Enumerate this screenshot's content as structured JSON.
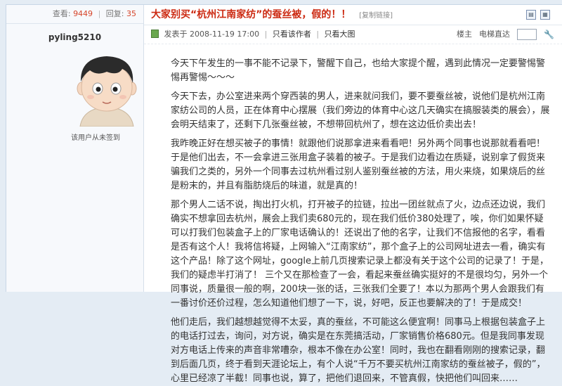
{
  "sidebar": {
    "views_label": "查看:",
    "views_value": "9449",
    "replies_label": "回复:",
    "replies_value": "35",
    "username": "pyling5210",
    "signed_status": "该用户从未签到"
  },
  "post": {
    "title": "大家别买“杭州江南家纺”的蚕丝被，假的！！",
    "copy_link": "[复制链接]",
    "posted_at": "发表于 2008-11-19 17:00",
    "author_only": "只看该作者",
    "read_large": "只看大图",
    "floor_label": "楼主",
    "goto_label": "电梯直达",
    "paragraphs": [
      "今天下午发生的一事不能不记录下，警醒下自己，也给大家提个醒，遇到此情况一定要警惕警惕再警惕～～～",
      "今天下去，办公室进来两个穿西装的男人，进来就问我们，要不要蚕丝被，说他们是杭州江南家纺公司的人员，正在体育中心摆展（我们旁边的体育中心这几天确实在搞服装类的展会），展会明天结束了，还剩下几张蚕丝被，不想带回杭州了，想在这边低价卖出去！",
      "我昨晚正好在想买被子的事情！就跟他们说那拿进来看看吧！另外两个同事也说那就看看吧！于是他们出去，不一会拿进三张用盒子装着的被子。于是我们边看边在质疑，说别拿了假货来骗我们之类的，另外一个同事去过杭州看过别人鉴别蚕丝被的方法，用火来烧，如果烧后的丝是粉末的，并且有脂肪烧后的味道，就是真的！",
      "那个男人二话不说，掏出打火机，打开被子的拉链，拉出一团丝就点了火，边点还边说，我们确实不想拿回去杭州，展会上我们卖680元的，现在我们低价380处理了，唉，你们如果怀疑可以打我们包装盒子上的厂家电话确认的！还说出了他的名字，让我们不信报他的名字，看看是否有这个人！我将信将疑，上网输入“江南家纺”，那个盒子上的公司网址进去一看，确实有这个产品！除了这个网址，google上前几页搜索记录上都没有关于这个公司的记录了！于是，我们的疑虑半打消了！ 三个又在那检查了一会，看起来蚕丝确实挺好的不是很均匀，另外一个同事说，质量很一般的啊，200块一张的话，三张我们全要了！本以为那两个男人会跟我们有一番讨价还价过程，怎么知道他们想了一下，说，好吧，反正也要解决的了！于是成交！",
      "他们走后，我们越想越觉得不太妥，真的蚕丝，不可能这么便宜啊！同事马上根据包装盒子上的电话打过去，询问，对方说，确实是在东莞搞活动，厂家销售价格680元。但是我同事发现对方电话上传来的声音非常嘈杂，根本不像在办公室！同时，我也在翻看刚刚的搜索记录，翻到后面几页，终于看到天涯论坛上，有个人说“千万不要买杭州江南家纺的蚕丝被子，假的”，心里已经凉了半截！同事也说，算了，把他们退回来，不管真假，快把他们叫回来……"
    ]
  }
}
